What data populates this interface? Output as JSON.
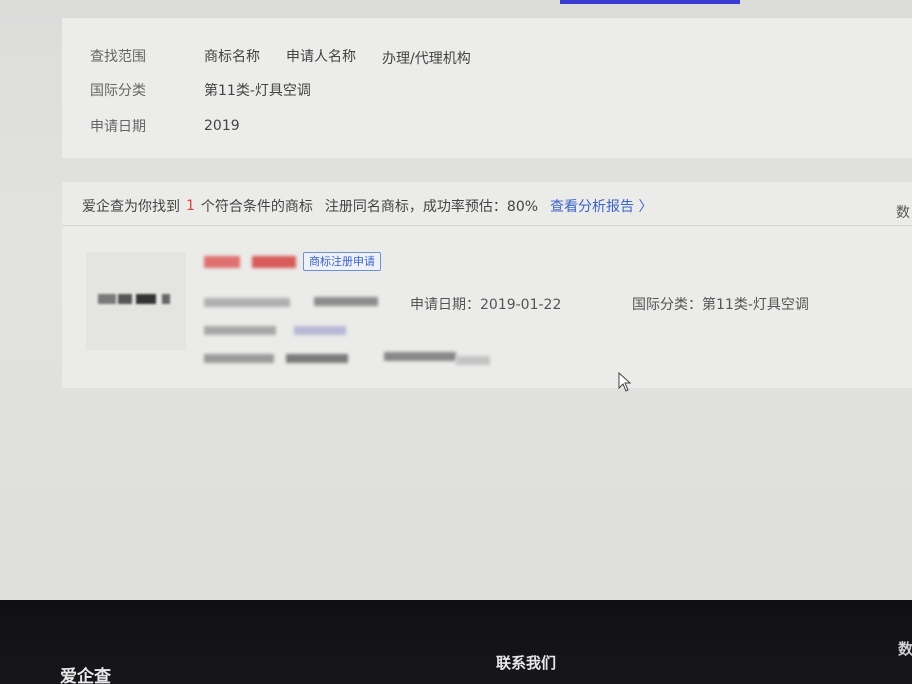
{
  "filter": {
    "scope_label": "查找范围",
    "scope_options": [
      "商标名称",
      "申请人名称",
      "办理/代理机构"
    ],
    "class_label": "国际分类",
    "class_value": "第11类-灯具空调",
    "date_label": "申请日期",
    "date_value": "2019"
  },
  "summary": {
    "prefix": "爱企查为你找到",
    "count": "1",
    "suffix": "个符合条件的商标",
    "note": "注册同名商标，成功率预估：80%",
    "link": "查看分析报告 〉",
    "edge_text": "数"
  },
  "result": {
    "status_tag": "商标注册申请",
    "apply_date": "申请日期：2019-01-22",
    "intl_class": "国际分类：第11类-灯具空调"
  },
  "footer": {
    "brand": "爱企查",
    "contact": "联系我们",
    "edge": "数"
  },
  "colors": {
    "accent_link": "#3b63c8",
    "count_red": "#e0413c",
    "footer_bg": "#101014"
  }
}
